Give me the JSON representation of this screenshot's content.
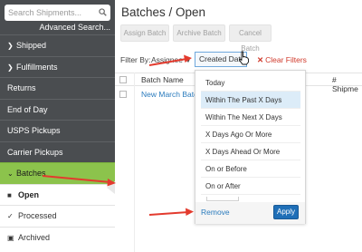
{
  "sidebar": {
    "search_placeholder": "Search Shipments...",
    "advanced_search": "Advanced Search...",
    "items": [
      {
        "label": "Shipped",
        "icon": "chevron-right"
      },
      {
        "label": "Fulfillments",
        "icon": "chevron-right"
      },
      {
        "label": "Returns",
        "icon": ""
      },
      {
        "label": "End of Day",
        "icon": ""
      },
      {
        "label": "USPS Pickups",
        "icon": ""
      },
      {
        "label": "Carrier Pickups",
        "icon": ""
      }
    ],
    "batches": {
      "label": "Batches",
      "icon": "chevron-down"
    },
    "sub_items": [
      {
        "label": "Open",
        "icon": "folder-open",
        "active": true
      },
      {
        "label": "Processed",
        "icon": "checkmark"
      },
      {
        "label": "Archived",
        "icon": "archive-box"
      }
    ]
  },
  "header": {
    "title": "Batches / Open",
    "buttons": [
      "Assign Batch",
      "Archive Batch",
      "Cancel Batch"
    ]
  },
  "filters": {
    "label": "Filter By:",
    "assignee": "Assignee",
    "created_date": "Created Date",
    "clear": "Clear Filters"
  },
  "table": {
    "headers": [
      "Batch Name",
      "# Shipme"
    ],
    "rows": [
      {
        "name": "New March Batch"
      }
    ]
  },
  "dropdown": {
    "options": [
      "Today",
      "Within The Past X Days",
      "Within The Next X Days",
      "X Days Ago Or More",
      "X Days Ahead Or More",
      "On or Before",
      "On or After"
    ],
    "selected_index": 1,
    "remove": "Remove",
    "apply": "Apply"
  },
  "colors": {
    "sidebar_bg": "#4a4d50",
    "batches_accent": "#8cc34c",
    "link_blue": "#2a7bbd",
    "apply_blue": "#1f6fb7",
    "clear_red": "#d0392b",
    "arrow_red": "#e33b2e"
  }
}
